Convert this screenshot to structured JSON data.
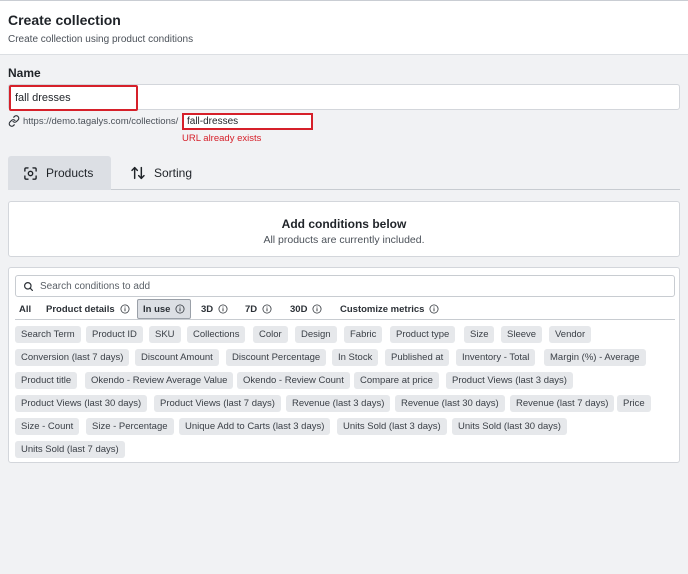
{
  "header": {
    "title": "Create collection",
    "subtitle": "Create collection using product conditions"
  },
  "name_section": {
    "label": "Name",
    "value": "fall dresses",
    "url_prefix": "https://demo.tagalys.com/collections/",
    "slug_value": "fall-dresses",
    "url_error": "URL already exists"
  },
  "tabs": [
    {
      "label": "Products",
      "icon": "product-scan-icon",
      "active": true
    },
    {
      "label": "Sorting",
      "icon": "sort-arrows-icon",
      "active": false
    }
  ],
  "conditions": {
    "title": "Add conditions below",
    "subtitle": "All products are currently included."
  },
  "search": {
    "placeholder": "Search conditions to add"
  },
  "filters": [
    {
      "label": "All"
    },
    {
      "label": "Product details"
    },
    {
      "label": "In use"
    },
    {
      "label": "3D"
    },
    {
      "label": "7D"
    },
    {
      "label": "30D"
    },
    {
      "label": "Customize metrics"
    }
  ],
  "chips": [
    "Search Term",
    "Product ID",
    "SKU",
    "Collections",
    "Color",
    "Design",
    "Fabric",
    "Product type",
    "Size",
    "Sleeve",
    "Vendor",
    "Conversion (last 7 days)",
    "Discount Amount",
    "Discount Percentage",
    "In Stock",
    "Published at",
    "Inventory - Total",
    "Margin (%) - Average",
    "Product title",
    "Okendo - Review Average Value",
    "Okendo - Review Count",
    "Compare at price",
    "Product Views (last 3 days)",
    "Product Views (last 30 days)",
    "Product Views (last 7 days)",
    "Revenue (last 3 days)",
    "Revenue (last 30 days)",
    "Revenue (last 7 days)",
    "Price",
    "Size - Count",
    "Size - Percentage",
    "Unique Add to Carts (last 3 days)",
    "Units Sold (last 3 days)",
    "Units Sold (last 30 days)",
    "Units Sold (last 7 days)"
  ],
  "colors": {
    "error": "#d6202a",
    "chip_bg": "#e6e8eb",
    "active_tab_bg": "#dcdfe4"
  }
}
